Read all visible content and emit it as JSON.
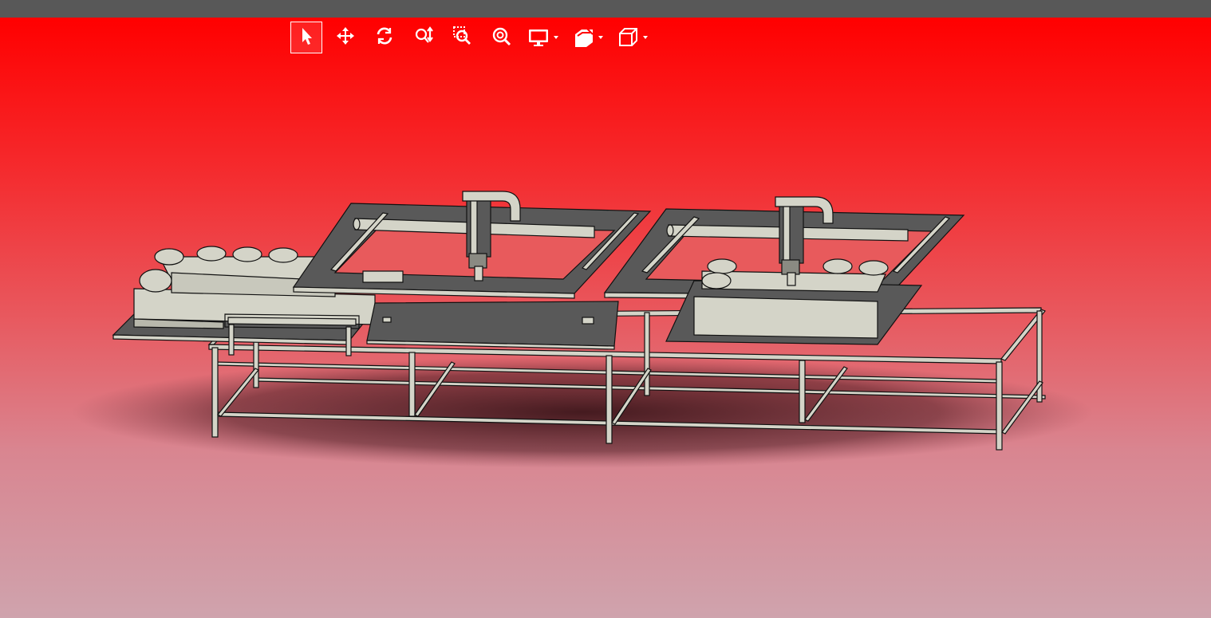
{
  "window": {
    "title_bar": ""
  },
  "toolbar": {
    "buttons": [
      {
        "name": "select-tool",
        "icon": "pointer-arrow-icon",
        "active": true
      },
      {
        "name": "pan-tool",
        "icon": "move-arrows-icon",
        "active": false
      },
      {
        "name": "rotate-tool",
        "icon": "rotate-icon",
        "active": false
      },
      {
        "name": "zoom-updown-tool",
        "icon": "zoom-updown-icon",
        "active": false
      },
      {
        "name": "zoom-window-tool",
        "icon": "zoom-window-icon",
        "active": false
      },
      {
        "name": "zoom-fit-tool",
        "icon": "zoom-fit-icon",
        "active": false
      }
    ],
    "dropdowns": [
      {
        "name": "display-mode-dropdown",
        "icon": "monitor-icon"
      },
      {
        "name": "section-view-dropdown",
        "icon": "section-view-icon"
      },
      {
        "name": "standard-views-dropdown",
        "icon": "cube-icon"
      }
    ]
  },
  "colors": {
    "toolbar_icon": "#ffffff",
    "bg_top": "#ff0000",
    "bg_bottom": "#cfa3ad",
    "model_face": "#d4d4c8",
    "model_dark": "#595959",
    "edge": "#111111"
  },
  "scene": {
    "description_visible_text": ""
  }
}
